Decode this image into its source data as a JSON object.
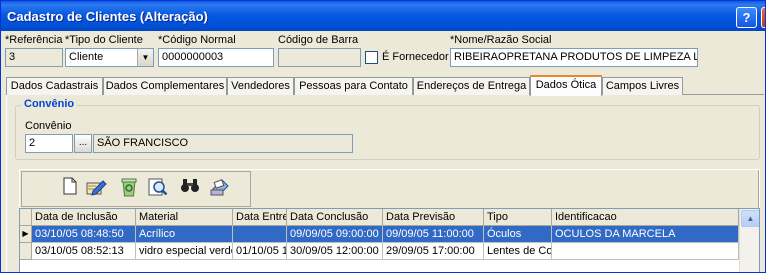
{
  "window": {
    "title": "Cadastro de Clientes (Alteração)",
    "help": "?"
  },
  "fields": {
    "referencia": {
      "label": "*Referência",
      "value": "3"
    },
    "tipo_cliente": {
      "label": "*Tipo do Cliente",
      "value": "Cliente"
    },
    "codigo_normal": {
      "label": "*Código Normal",
      "value": "0000000003"
    },
    "codigo_barra": {
      "label": "Código de Barra",
      "value": ""
    },
    "fornecedor": {
      "label": "É Fornecedor",
      "checked": false
    },
    "nome": {
      "label": "*Nome/Razão Social",
      "value": "RIBEIRAOPRETANA PRODUTOS DE LIMPEZA L"
    }
  },
  "tabs": [
    {
      "label": "Dados Cadastrais",
      "active": false
    },
    {
      "label": "Dados Complementares",
      "active": false
    },
    {
      "label": "Vendedores",
      "active": false
    },
    {
      "label": "Pessoas para Contato",
      "active": false
    },
    {
      "label": "Endereços de Entrega",
      "active": false
    },
    {
      "label": "Dados Ótica",
      "active": true
    },
    {
      "label": "Campos Livres",
      "active": false
    }
  ],
  "convenio": {
    "group_title": "Convênio",
    "label": "Convênio",
    "code": "2",
    "lookup_button": "...",
    "name": "SÃO FRANCISCO"
  },
  "toolbar": {
    "icons": [
      "new-document-icon",
      "edit-icon",
      "recycle-delete-icon",
      "search-icon",
      "binoculars-icon",
      "print-icon"
    ]
  },
  "grid": {
    "columns": [
      "Data de Inclusão",
      "Material",
      "Data Entre",
      "Data Conclusão",
      "Data Previsão",
      "Tipo",
      "Identificacao"
    ],
    "rows": [
      [
        "03/10/05 08:48:50",
        "Acrílico",
        "",
        "09/09/05 09:00:00",
        "09/09/05 11:00:00",
        "Óculos",
        "OCULOS DA MARCELA"
      ],
      [
        "03/10/05 08:52:13",
        "vidro especial verde",
        "01/10/05 1",
        "30/09/05 12:00:00",
        "29/09/05 17:00:00",
        "Lentes de Co",
        ""
      ]
    ],
    "selected_row": 0
  },
  "colors": {
    "title_bar": "#0859e0",
    "selection": "#316ac5",
    "active_tab_accent": "#e68b2c",
    "group_title": "#0046d5"
  }
}
